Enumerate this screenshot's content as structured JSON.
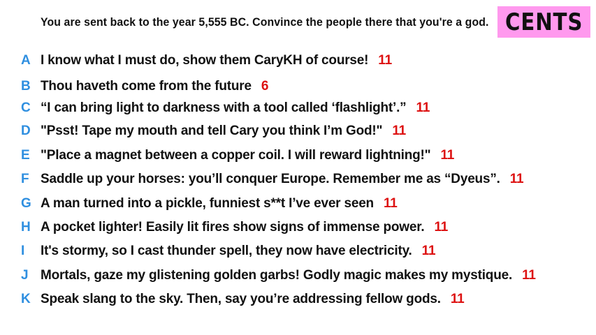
{
  "question": "You are sent back to the year 5,555 BC. Convince the people there that you're a god.",
  "badge_label": "CENTS",
  "colors": {
    "badge_bg": "#ff99ee",
    "letter": "#2f8fe0",
    "score": "#dd1111",
    "text": "#111111"
  },
  "answers": [
    {
      "letter": "A",
      "text": "I know what I must do, show them CaryKH of course!",
      "score": "11"
    },
    {
      "letter": "B",
      "text": "Thou haveth come from the future",
      "score": "6"
    },
    {
      "letter": "C",
      "text": "“I can bring light to darkness with a tool called ‘flashlight’.”",
      "score": "11"
    },
    {
      "letter": "D",
      "text": "\"Psst! Tape my mouth and tell Cary you think I’m God!\"",
      "score": "11"
    },
    {
      "letter": "E",
      "text": "\"Place a magnet between a copper coil. I will reward lightning!\"",
      "score": "11"
    },
    {
      "letter": "F",
      "text": "Saddle up your horses: you’ll conquer Europe. Remember me as “Dyeus”.",
      "score": "11"
    },
    {
      "letter": "G",
      "text": "A man turned into a pickle, funniest s**t I’ve ever seen",
      "score": "11"
    },
    {
      "letter": "H",
      "text": "A pocket lighter! Easily lit fires show signs of immense power.",
      "score": "11"
    },
    {
      "letter": "I",
      "text": "It's stormy, so I cast thunder spell, they now have electricity.",
      "score": "11"
    },
    {
      "letter": "J",
      "text": "Mortals, gaze my glistening golden garbs! Godly magic makes my mystique.",
      "score": "11"
    },
    {
      "letter": "K",
      "text": "Speak slang to the sky. Then, say you’re addressing fellow gods.",
      "score": "11"
    }
  ]
}
